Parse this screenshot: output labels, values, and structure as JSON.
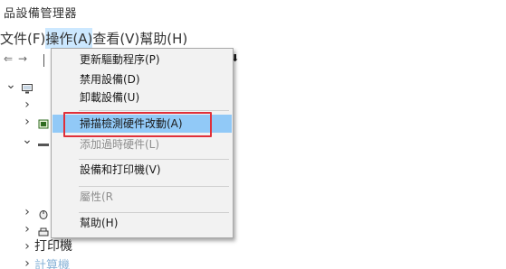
{
  "window": {
    "title": "品設備管理器"
  },
  "menubar": {
    "file": "文件(F)",
    "action": "操作(A)",
    "view": "查看(V)",
    "help": "幫助(H)"
  },
  "context_menu": {
    "items": [
      {
        "label": "更新驅動程序(P)",
        "enabled": true
      },
      {
        "label": "禁用設備(D)",
        "enabled": true
      },
      {
        "label": "卸載設備(U)",
        "enabled": true
      },
      {
        "label": "掃描檢測硬件改動(A)",
        "enabled": true,
        "highlighted": true
      },
      {
        "label": "添加過時硬件(L)",
        "enabled": false
      },
      {
        "label": "設備和打印機(V)",
        "enabled": true
      },
      {
        "label": "屬性(R",
        "enabled": false
      },
      {
        "label": "幫助(H)",
        "enabled": true
      }
    ]
  },
  "tree": {
    "printers_label": "打印機",
    "computer_label": "計算機"
  },
  "colors": {
    "menu_highlight": "#91c9f7",
    "menubar_active": "#cce8ff",
    "annotation_border": "#e0303a"
  }
}
